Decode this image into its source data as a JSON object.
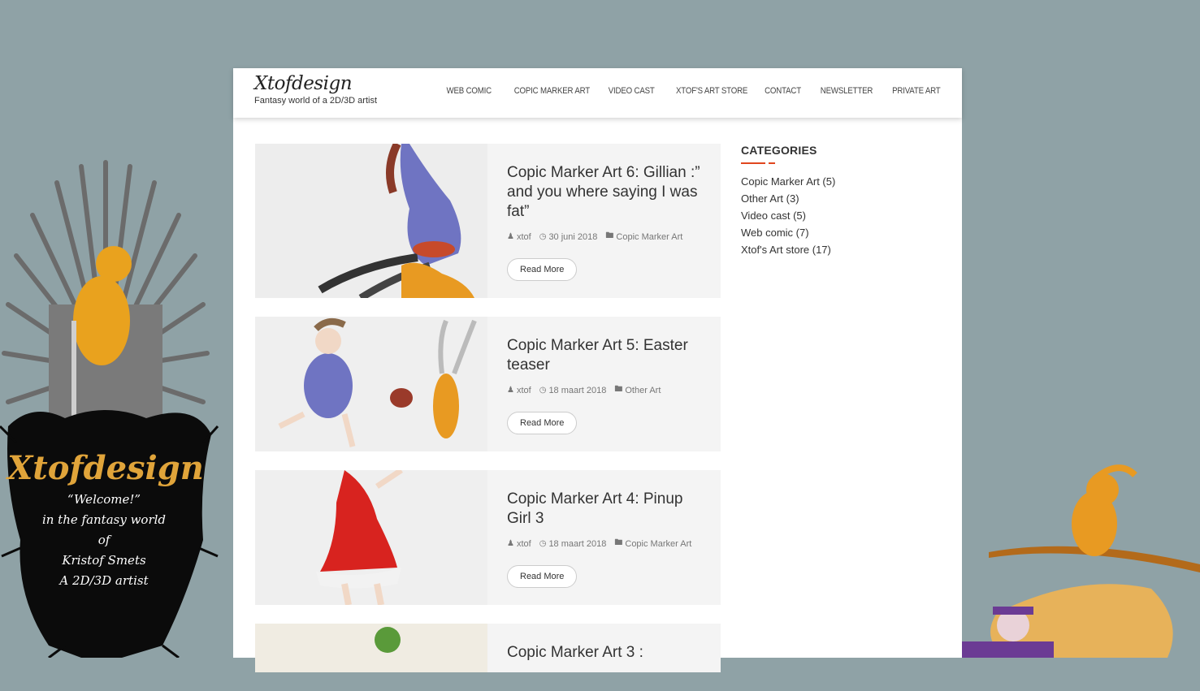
{
  "site": {
    "title": "Xtofdesign",
    "tagline": "Fantasy world of a 2D/3D artist"
  },
  "nav": [
    {
      "label": "WEB COMIC"
    },
    {
      "label": "COPIC MARKER ART"
    },
    {
      "label": "VIDEO CAST"
    },
    {
      "label": "XTOF'S ART STORE"
    },
    {
      "label": "CONTACT"
    },
    {
      "label": "NEWSLETTER"
    },
    {
      "label": "PRIVATE ART"
    }
  ],
  "posts": [
    {
      "title": "Copic Marker Art 6: Gillian :” and you where saying I was fat”",
      "author": "xtof",
      "date": "30 juni 2018",
      "category": "Copic Marker Art",
      "button": "Read More"
    },
    {
      "title": "Copic Marker Art 5: Easter teaser",
      "author": "xtof",
      "date": "18 maart 2018",
      "category": "Other Art",
      "button": "Read More"
    },
    {
      "title": "Copic Marker Art 4: Pinup Girl 3",
      "author": "xtof",
      "date": "18 maart 2018",
      "category": "Copic Marker Art",
      "button": "Read More"
    },
    {
      "title": "Copic Marker Art 3 :",
      "author": "",
      "date": "",
      "category": "",
      "button": ""
    }
  ],
  "sidebar": {
    "heading": "CATEGORIES",
    "categories": [
      {
        "label": "Copic Marker Art (5)"
      },
      {
        "label": "Other Art (3)"
      },
      {
        "label": "Video cast (5)"
      },
      {
        "label": "Web comic (7)"
      },
      {
        "label": "Xtof's Art store (17)"
      }
    ]
  },
  "banner": {
    "brand": "Xtofdesign",
    "lines": [
      "“Welcome!”",
      "in the fantasy world",
      "of",
      "Kristof Smets",
      "A 2D/3D artist"
    ]
  },
  "colors": {
    "background": "#8fa2a6",
    "accent": "#e0461e"
  }
}
